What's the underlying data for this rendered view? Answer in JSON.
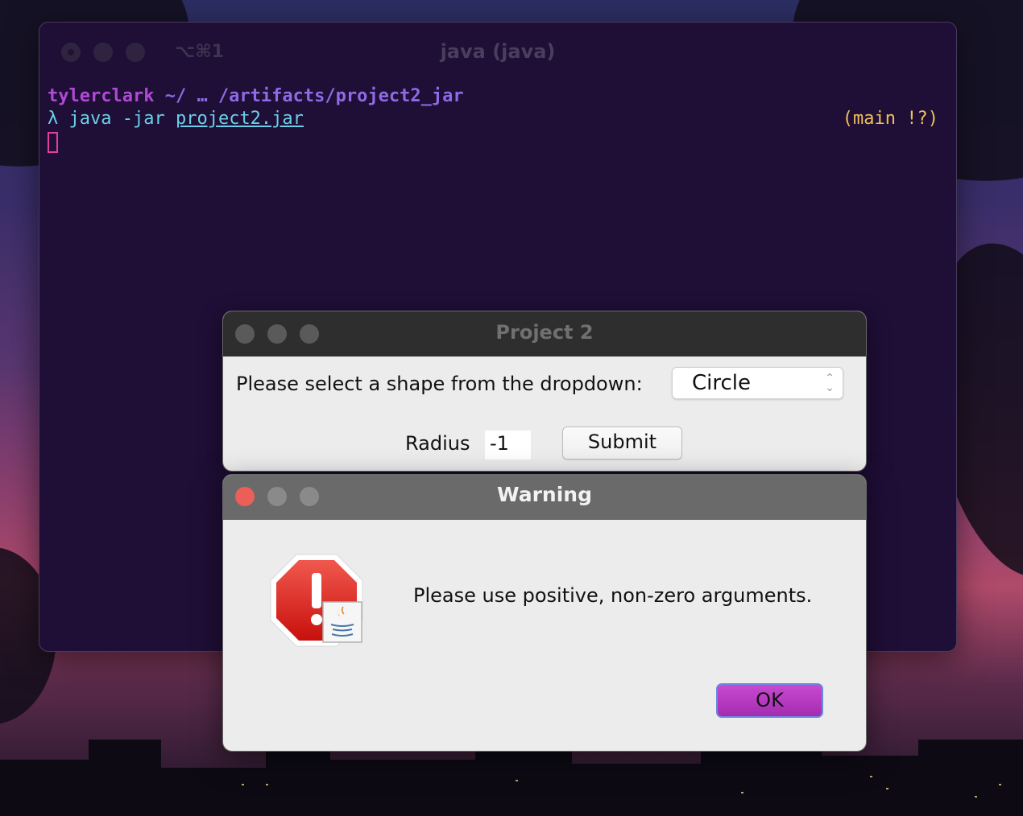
{
  "terminal": {
    "shortcut": "⌥⌘1",
    "title": "java (java)",
    "prompt_user": "tylerclark",
    "prompt_path": "~/ … /artifacts/project2_jar",
    "prompt_symbol": "λ",
    "command": "java",
    "command_flag": "-jar",
    "command_arg": "project2.jar",
    "git_status": "(main !?)"
  },
  "project_window": {
    "title": "Project 2",
    "shape_prompt": "Please select a shape from the dropdown:",
    "shape_selected": "Circle",
    "radius_label": "Radius",
    "radius_value": "-1",
    "submit_label": "Submit"
  },
  "warning_dialog": {
    "title": "Warning",
    "message": "Please use positive, non-zero arguments.",
    "ok_label": "OK",
    "icon": "stop-sign-warning-icon"
  },
  "colors": {
    "terminal_bg": "#1f0e36",
    "ok_button": "#b53cbf",
    "close_dot": "#ec5f59"
  }
}
